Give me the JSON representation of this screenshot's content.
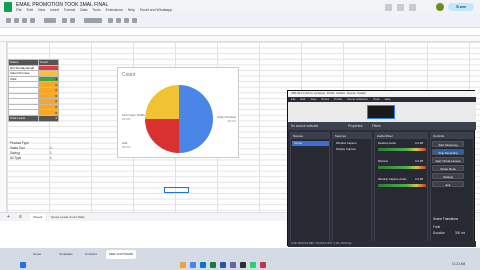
{
  "app": {
    "doc_title": "EMAIL PROMOTION TOOK 3MAL FINAL",
    "share_label": "Share"
  },
  "menus": [
    "File",
    "Edit",
    "View",
    "Insert",
    "Format",
    "Data",
    "Tools",
    "Extensions",
    "Help",
    "Email and Whatsapp"
  ],
  "table": {
    "header": [
      "Status",
      "Count"
    ],
    "rows": [
      {
        "label": "Not Sunday Email",
        "value": "",
        "color": "#e53935"
      },
      {
        "label": "Client Promise",
        "value": "",
        "color": "#fbc02d"
      },
      {
        "label": "Click",
        "value": "4",
        "color": "#43a047"
      },
      {
        "label": "",
        "value": "0",
        "color": "#f9a825"
      },
      {
        "label": "",
        "value": "0",
        "color": "#f9a825"
      },
      {
        "label": "",
        "value": "0",
        "color": "#f9a825"
      },
      {
        "label": "",
        "value": "0",
        "color": "#f9a825"
      },
      {
        "label": "",
        "value": "0",
        "color": "#f9a825"
      },
      {
        "label": "",
        "value": "0",
        "color": "#f9a825"
      }
    ],
    "total_label": "Total Leads",
    "total_value": "4"
  },
  "product": {
    "title": "Product Type",
    "rows": [
      {
        "label": "Sales Tool",
        "value": "1"
      },
      {
        "label": "Saving",
        "value": "1"
      },
      {
        "label": "All Type",
        "value": "1"
      }
    ]
  },
  "chart_data": {
    "type": "pie",
    "title": "Count",
    "values": [
      50,
      25,
      25
    ],
    "colors": [
      "#4a86e8",
      "#d93030",
      "#f1c232"
    ],
    "labels": [
      "Last Open Tariffs",
      "Order Product",
      "Add"
    ],
    "value_labels": [
      "50.0%",
      "25.0%",
      "25.0%"
    ]
  },
  "sheet_tabs": [
    "Sheet1",
    "Quote Leads Count Daily"
  ],
  "taskbar": {
    "items": [
      "Home",
      "Templates",
      "Contacts",
      "MEE SOFTWARE"
    ],
    "clock": "11:22 AM"
  },
  "obs": {
    "title": "OBS 29.0.0 (64-bit, windows) - Profile: Untitled - Scenes: Untitled",
    "menu": [
      "File",
      "Edit",
      "View",
      "Docks",
      "Profile",
      "Scene Collection",
      "Tools",
      "Help"
    ],
    "source_label": "No source selected",
    "properties_label": "Properties",
    "filters_label": "Filters",
    "docks": {
      "scenes": "Scenes",
      "sources": "Sources",
      "mixer": "Audio Mixer",
      "transitions": "Scene Transitions",
      "controls": "Controls"
    },
    "scene_items": [
      "Scene"
    ],
    "source_items": [
      "Window Capture",
      "Display Capture"
    ],
    "mixer_items": [
      "Desktop Audio",
      "Mic/Aux",
      "Window Capture Audio"
    ],
    "mixer_db": [
      "0.0 dB",
      "0.0 dB",
      "0.0 dB"
    ],
    "transition_type": "Fade",
    "duration_label": "Duration",
    "duration_value": "300 ms",
    "controls": [
      "Start Streaming",
      "Stop Recording",
      "Start Virtual Camera",
      "Studio Mode",
      "Settings",
      "Exit"
    ],
    "status": "LIVE: 00:00:00   REC: 00:00:52   CPU: 3.4%, 30.00 fps"
  }
}
